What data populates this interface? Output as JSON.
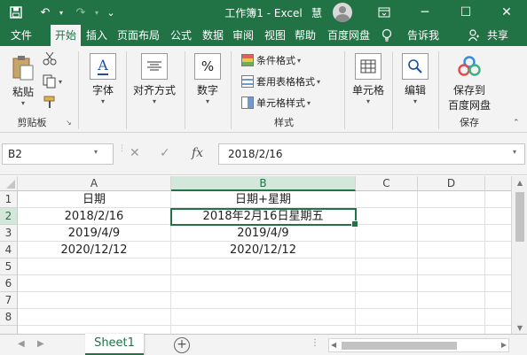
{
  "title_bar": {
    "title": "工作簿1  -  Excel",
    "user_name": "慧",
    "minimize": "─",
    "restore": "▭",
    "maximize": "☐",
    "close": "✕",
    "save_icon": "save-icon",
    "undo": "↶",
    "redo": "↷",
    "qa_more": "⌄"
  },
  "tabs": [
    "文件",
    "开始",
    "插入",
    "页面布局",
    "公式",
    "数据",
    "审阅",
    "视图",
    "帮助",
    "百度网盘"
  ],
  "tell_me": "告诉我",
  "share": "共享",
  "ribbon": {
    "paste": "粘贴",
    "clipboard_group": "剪贴板",
    "font": "字体",
    "alignment": "对齐方式",
    "number": "数字",
    "conditional_format": "条件格式",
    "format_as_table": "套用表格格式",
    "cell_styles": "单元格样式",
    "styles_group": "样式",
    "cells": "单元格",
    "editing": "编辑",
    "save_to_baidu_line1": "保存到",
    "save_to_baidu_line2": "百度网盘",
    "save_group": "保存",
    "number_symbol": "%",
    "font_symbol": "A"
  },
  "formula_bar": {
    "name_box": "B2",
    "cancel": "✕",
    "enter": "✓",
    "fx": "fx",
    "formula": "2018/2/16"
  },
  "columns": [
    "A",
    "B",
    "C",
    "D"
  ],
  "rows": [
    "1",
    "2",
    "3",
    "4",
    "5",
    "6",
    "7",
    "8"
  ],
  "cells": {
    "A1": "日期",
    "B1": "日期+星期",
    "A2": "2018/2/16",
    "B2": "2018年2月16日星期五",
    "A3": "2019/4/9",
    "B3": "2019/4/9",
    "A4": "2020/12/12",
    "B4": "2020/12/12"
  },
  "sheet": {
    "active_tab": "Sheet1",
    "add": "+"
  },
  "colors": {
    "accent": "#217346",
    "selection_header": "#d3e7db"
  }
}
